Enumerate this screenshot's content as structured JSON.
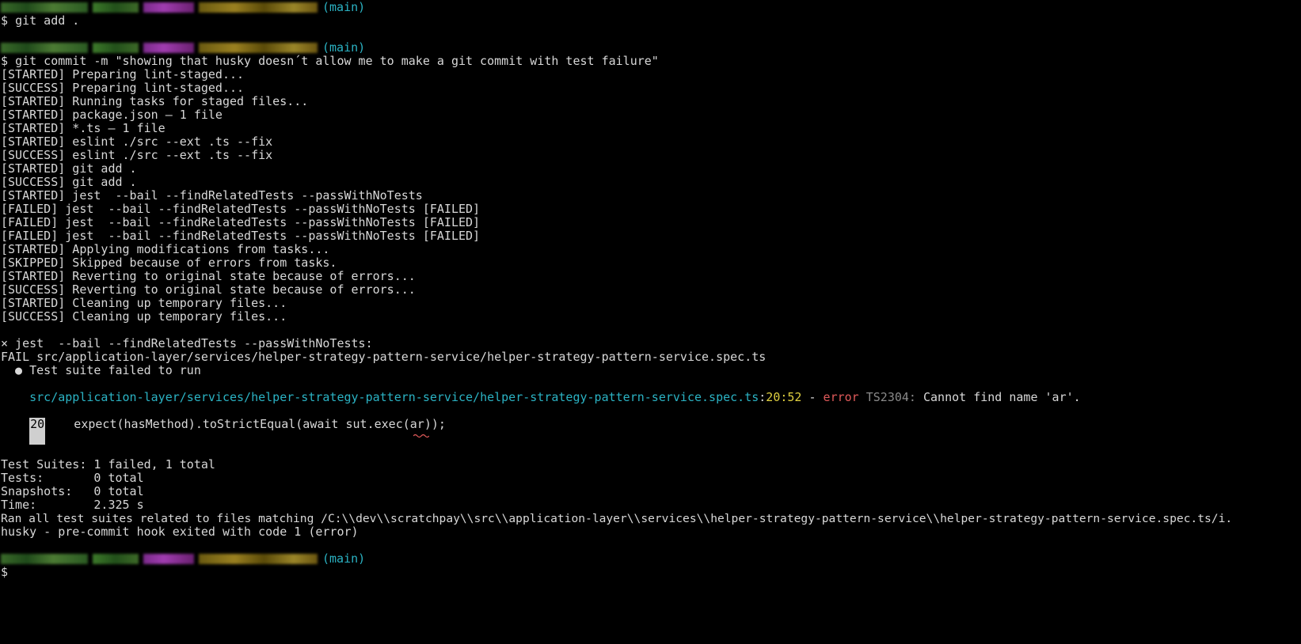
{
  "prompt": {
    "branch": "(main)",
    "symbol": "$"
  },
  "commands": {
    "add": "git add .",
    "commit": "git commit -m \"showing that husky doesn´t allow me to make a git commit with test failure\""
  },
  "log_lines": [
    "[STARTED] Preparing lint-staged...",
    "[SUCCESS] Preparing lint-staged...",
    "[STARTED] Running tasks for staged files...",
    "[STARTED] package.json — 1 file",
    "[STARTED] *.ts — 1 file",
    "[STARTED] eslint ./src --ext .ts --fix",
    "[SUCCESS] eslint ./src --ext .ts --fix",
    "[STARTED] git add .",
    "[SUCCESS] git add .",
    "[STARTED] jest  --bail --findRelatedTests --passWithNoTests",
    "[FAILED] jest  --bail --findRelatedTests --passWithNoTests [FAILED]",
    "[FAILED] jest  --bail --findRelatedTests --passWithNoTests [FAILED]",
    "[FAILED] jest  --bail --findRelatedTests --passWithNoTests [FAILED]",
    "[STARTED] Applying modifications from tasks...",
    "[SKIPPED] Skipped because of errors from tasks.",
    "[STARTED] Reverting to original state because of errors...",
    "[SUCCESS] Reverting to original state because of errors...",
    "[STARTED] Cleaning up temporary files...",
    "[SUCCESS] Cleaning up temporary files..."
  ],
  "error_block": {
    "task_failed": "× jest  --bail --findRelatedTests --passWithNoTests:",
    "fail_line": "FAIL src/application-layer/services/helper-strategy-pattern-service/helper-strategy-pattern-service.spec.ts",
    "suite_failed": "  ● Test suite failed to run",
    "file_path": "src/application-layer/services/helper-strategy-pattern-service/helper-strategy-pattern-service.spec.ts",
    "position": "20:52",
    "dash": " - ",
    "error_word": "error",
    "error_code": "TS2304:",
    "error_message": "Cannot find name 'ar'.",
    "code_line_number": "20",
    "code_line": "    expect(hasMethod).toStrictEqual(await sut.exec(ar));"
  },
  "summary": {
    "suites": "Test Suites: 1 failed, 1 total",
    "tests": "Tests:       0 total",
    "snapshots": "Snapshots:   0 total",
    "time": "Time:        2.325 s",
    "ran_all": "Ran all test suites related to files matching /C:\\\\dev\\\\scratchpay\\\\src\\\\application-layer\\\\services\\\\helper-strategy-pattern-service\\\\helper-strategy-pattern-service.spec.ts/i.",
    "husky": "husky - pre-commit hook exited with code 1 (error)"
  },
  "colors": {
    "background": "#000000",
    "text": "#d8d8d8",
    "cyan": "#2bb3c4",
    "yellow": "#e0d040",
    "red": "#e05a5a"
  }
}
